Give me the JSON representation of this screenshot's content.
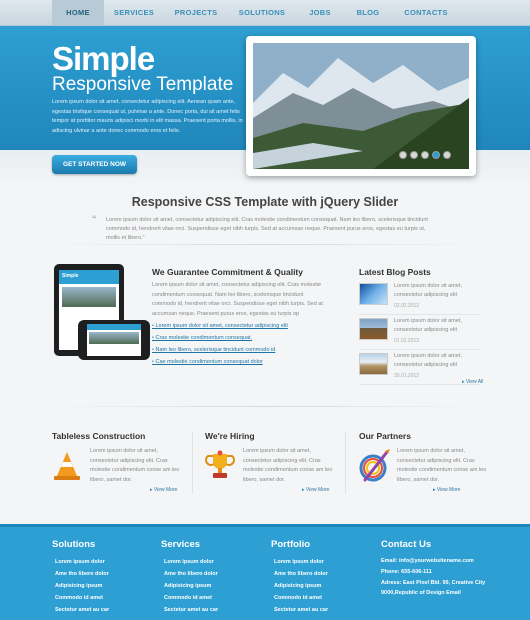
{
  "nav": {
    "items": [
      {
        "label": "HOME",
        "active": true
      },
      {
        "label": "SERVICES",
        "active": false
      },
      {
        "label": "PROJECTS",
        "active": false
      },
      {
        "label": "SOLUTIONS",
        "active": false
      },
      {
        "label": "JOBS",
        "active": false
      },
      {
        "label": "BLOG",
        "active": false
      },
      {
        "label": "CONTACTS",
        "active": false
      }
    ]
  },
  "hero": {
    "title": "Simple",
    "subtitle": "Responsive Template",
    "text": "Lorem ipsum dolor sit amet, consectetur adipiscing elit. Aenean quam ante, egestas tristique consequat ut, pulvinar a ante. Donec porta, dui sit amet felis tempor at porttitor mauris adipisci morbi in elit massa. Praesent porta mollis, in adiscing ulvinar a ante donec commodo eros et felis.",
    "cta_label": "GET STARTED NOW",
    "slider_dot_count": 5,
    "slider_active_dot": 4
  },
  "intro": {
    "title": "Responsive CSS Template with jQuery Slider",
    "quote_glyph": "“",
    "text": "Lorem ipsum dolor sit amet, consectetur adipiscing elit. Cras molestie condimentum consequat. Nam leo libero, scelerisque tincidunt commodo id, hendrerit vitae orci. Suspendisse eget nibh turpis. Sed at accumsan neque. Praesent purus eros, egestas eu turpis ut, mollis et libero.”"
  },
  "guarantee": {
    "title": "We Guarantee Commitment & Quality",
    "text": "Lorem ipsum dolor sit amet, consectetur adipiscing elit. Cras molestie condimentum consequat. Nam leo libero, scelerisque tincidunt commodo id, hendrerit vitae orci. Suspendisse eget nibh turpis. Sed at accumsan neque. Praesent purus eros, egestas eu turpis op",
    "bullet": "▪",
    "links": [
      "Lorem ipsum dolor sit amet, consectetur adipiscing elit",
      "Cras molestie condimentum consequat.",
      "Nam leo libero, scelerisque tincidunt commodo id",
      "Cae molestie condimentum consequat dolor"
    ],
    "device_brand": "Simple"
  },
  "blog": {
    "title": "Latest Blog Posts",
    "posts": [
      {
        "text": "Lorem ipsum dolor sit amet, consectetur adipiscing elit",
        "date": "02.02.2012"
      },
      {
        "text": "Lorem ipsum dolor sit amet, consectetur adipiscing elit",
        "date": "01.02.2012"
      },
      {
        "text": "Lorem ipsum dolor sit amet, consectetur adipiscing elit",
        "date": "30.01.2012"
      }
    ],
    "view_all": "▸ View All"
  },
  "features": [
    {
      "title": "Tableless Construction",
      "text": "Lorem ipsum dolor sit amet, consectetur adipiscing elit. Cras molestie condimentum conse am leo libero, samet dor.",
      "view_more": "▸ View More"
    },
    {
      "title": "We're Hiring",
      "text": "Lorem ipsum dolor sit amet, consectetur adipiscing elit. Cras molestie condimentum conse am leo libero, samet dor.",
      "view_more": "▸ View More"
    },
    {
      "title": "Our Partners",
      "text": "Lorem ipsum dolor sit amet, consectetur adipiscing elit. Cras molestie condimentum conse am leo libero, samet dor.",
      "view_more": "▸ View More"
    }
  ],
  "footer": {
    "columns": [
      {
        "title": "Solutions",
        "items": [
          "Lorem ipsum dolor",
          "Ame tho libero dolor",
          "Adipisicing ipsum",
          "Commodo id amet",
          "Sectetur amet au car"
        ]
      },
      {
        "title": "Services",
        "items": [
          "Lorem ipsum dolor",
          "Ame tho libero dolor",
          "Adipisicing ipsum",
          "Commodo id amet",
          "Sectetur amet au car"
        ]
      },
      {
        "title": "Portfolio",
        "items": [
          "Lorem ipsum dolor",
          "Ame tho libero dolor",
          "Adipisicing ipsum",
          "Commodo id amet",
          "Sectetur amet au car"
        ]
      }
    ],
    "contact": {
      "title": "Contact Us",
      "email": "Email: info@yourwebsitename.com",
      "phone": "Phone: 655-606-111",
      "address": "Adress: East Pixel Bld. 99, Creative City 9000,Republic of Design Email"
    }
  },
  "colors": {
    "accent": "#2e9fd2",
    "dark_accent": "#1f86bb",
    "link": "#1e74a3"
  }
}
